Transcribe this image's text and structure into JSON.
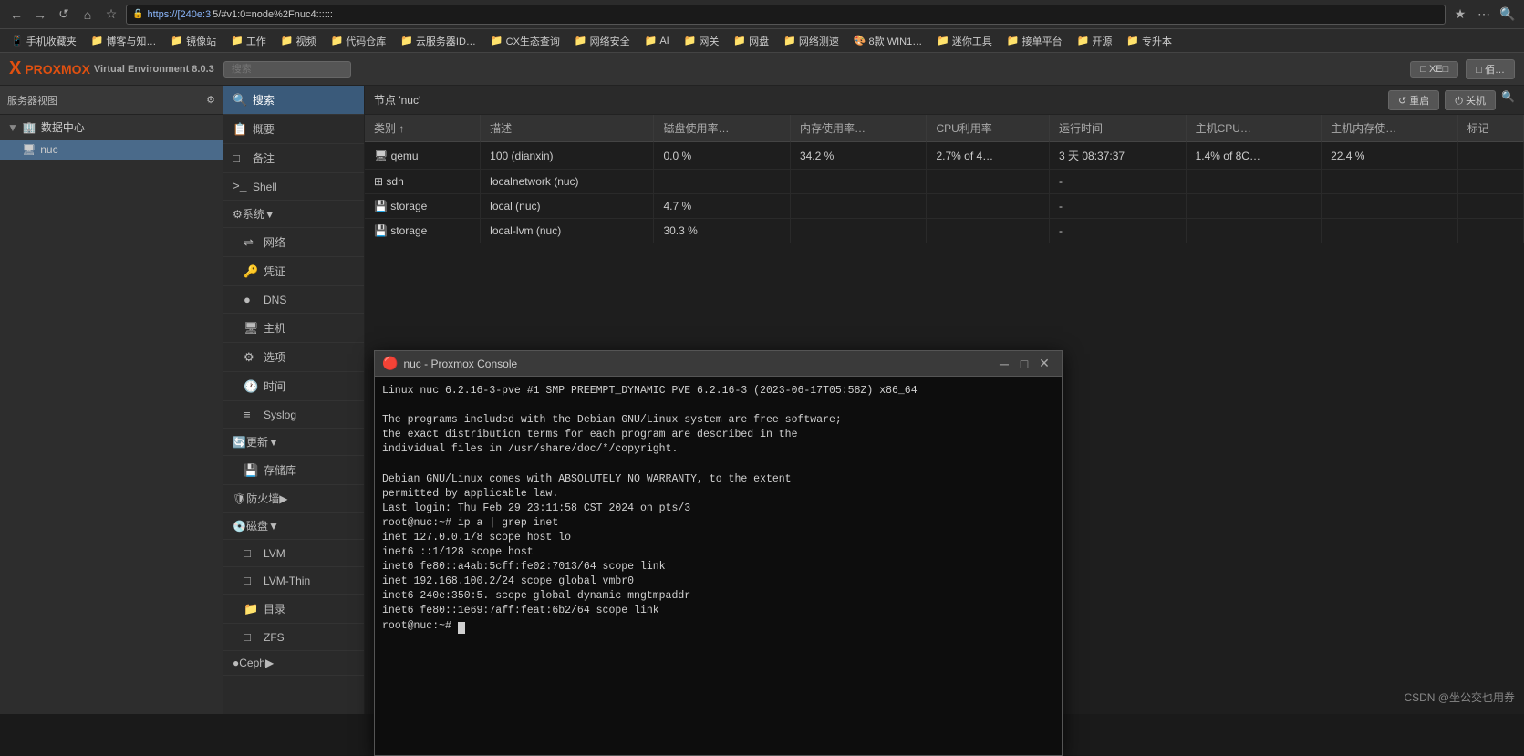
{
  "browser": {
    "url": "https://[240e:3",
    "url_full": "5/#v1:0=node%2Fnuc4::::::",
    "nav_back": "←",
    "nav_forward": "→",
    "nav_refresh": "↺",
    "nav_home": "⌂"
  },
  "bookmarks": [
    {
      "label": "手机收藏夹",
      "type": "folder"
    },
    {
      "label": "博客与知…",
      "type": "folder"
    },
    {
      "label": "镜像站",
      "type": "folder"
    },
    {
      "label": "工作",
      "type": "folder"
    },
    {
      "label": "视频",
      "type": "folder"
    },
    {
      "label": "代码仓库",
      "type": "folder"
    },
    {
      "label": "云服务器ID…",
      "type": "folder"
    },
    {
      "label": "CX生态查询",
      "type": "folder"
    },
    {
      "label": "网络安全",
      "type": "folder"
    },
    {
      "label": "AI",
      "type": "folder"
    },
    {
      "label": "网关",
      "type": "folder"
    },
    {
      "label": "网盘",
      "type": "folder"
    },
    {
      "label": "网络测速",
      "type": "folder"
    },
    {
      "label": "8款 WIN1…",
      "type": "folder"
    },
    {
      "label": "迷你工具",
      "type": "folder"
    },
    {
      "label": "接单平台",
      "type": "folder"
    },
    {
      "label": "开源",
      "type": "folder"
    },
    {
      "label": "专升本",
      "type": "folder"
    }
  ],
  "pve": {
    "logo_x": "X",
    "logo_name": "PROXMOX",
    "logo_ve": "Virtual Environment 8.0.3",
    "search_placeholder": "搜索",
    "header_buttons": [
      "□ XE□",
      "□ 佰…"
    ]
  },
  "sidebar": {
    "view_label": "服务器视图",
    "settings_icon": "⚙",
    "datacenter_label": "数据中心",
    "nodes": [
      {
        "label": "nuc",
        "icon": "🖥",
        "selected": true
      }
    ]
  },
  "nav": {
    "items": [
      {
        "icon": "🔍",
        "label": "搜索",
        "active": true
      },
      {
        "icon": "📋",
        "label": "概要"
      },
      {
        "icon": "□",
        "label": "备注"
      },
      {
        "icon": ">_",
        "label": "Shell"
      },
      {
        "icon": "⚙",
        "label": "系统",
        "has_arrow": true
      },
      {
        "icon": "🌐",
        "label": "网络",
        "indent": true
      },
      {
        "icon": "🔑",
        "label": "凭证",
        "indent": true
      },
      {
        "icon": "●",
        "label": "DNS",
        "indent": true
      },
      {
        "icon": "🖥",
        "label": "主机",
        "indent": true
      },
      {
        "icon": "⚙",
        "label": "选项",
        "indent": true
      },
      {
        "icon": "🕐",
        "label": "时间",
        "indent": true
      },
      {
        "icon": "≡",
        "label": "Syslog",
        "indent": true
      },
      {
        "icon": "🔄",
        "label": "更新",
        "has_arrow": true
      },
      {
        "icon": "💾",
        "label": "存储库",
        "indent": true
      },
      {
        "icon": "🛡",
        "label": "防火墙",
        "has_arrow": true
      },
      {
        "icon": "💿",
        "label": "磁盘",
        "has_arrow": true
      },
      {
        "icon": "□",
        "label": "LVM",
        "indent": true
      },
      {
        "icon": "□",
        "label": "LVM-Thin",
        "indent": true
      },
      {
        "icon": "📁",
        "label": "目录",
        "indent": true
      },
      {
        "icon": "□",
        "label": "ZFS",
        "indent": true
      },
      {
        "icon": "●",
        "label": "Ceph",
        "has_arrow": true
      }
    ]
  },
  "node_header": {
    "label": "节点 'nuc'",
    "btn_restart": "↺ 重启",
    "btn_shutdown": "⏻ 关机",
    "btn_search": "搜"
  },
  "table": {
    "columns": [
      "类别 ↑",
      "描述",
      "磁盘使用率…",
      "内存使用率…",
      "CPU利用率",
      "运行时间",
      "主机CPU…",
      "主机内存使…",
      "标记"
    ],
    "rows": [
      {
        "type": "vm",
        "type_icon": "🖥",
        "name": "qemu",
        "desc": "100 (dianxin)",
        "disk": "0.0 %",
        "mem": "34.2 %",
        "cpu": "2.7% of 4…",
        "uptime": "3 天 08:37:37",
        "hcpu": "1.4% of 8C…",
        "hmem": "22.4 %",
        "tag": ""
      },
      {
        "type": "net",
        "type_icon": "⊞",
        "name": "sdn",
        "desc": "localnetwork (nuc)",
        "disk": "",
        "mem": "",
        "cpu": "",
        "uptime": "-",
        "hcpu": "",
        "hmem": "",
        "tag": ""
      },
      {
        "type": "storage",
        "type_icon": "💾",
        "name": "storage",
        "desc": "local (nuc)",
        "disk": "4.7 %",
        "mem": "",
        "cpu": "",
        "uptime": "-",
        "hcpu": "",
        "hmem": "",
        "tag": ""
      },
      {
        "type": "storage",
        "type_icon": "💾",
        "name": "storage",
        "desc": "local-lvm (nuc)",
        "disk": "30.3 %",
        "mem": "",
        "cpu": "",
        "uptime": "-",
        "hcpu": "",
        "hmem": "",
        "tag": ""
      }
    ]
  },
  "console": {
    "title": "nuc - Proxmox Console",
    "favicon": "🔴",
    "terminal_lines": [
      "Linux nuc 6.2.16-3-pve #1 SMP PREEMPT_DYNAMIC PVE 6.2.16-3 (2023-06-17T05:58Z) x86_64",
      "",
      "The programs included with the Debian GNU/Linux system are free software;",
      "the exact distribution terms for each program are described in the",
      "individual files in /usr/share/doc/*/copyright.",
      "",
      "Debian GNU/Linux comes with ABSOLUTELY NO WARRANTY, to the extent",
      "permitted by applicable law.",
      "Last login: Thu Feb 29 23:11:58 CST 2024 on pts/3",
      "root@nuc:~# ip a | grep inet",
      "    inet 127.0.0.1/8 scope host lo",
      "    inet6 ::1/128 scope host",
      "    inet6 fe80::a4ab:5cff:fe02:7013/64 scope link",
      "    inet 192.168.100.2/24 scope global vmbr0",
      "    inet6 240e:350:5.              scope global dynamic mngtmpaddr",
      "    inet6 fe80::1e69:7aff:feat:6b2/64 scope link",
      "root@nuc:~# "
    ]
  },
  "watermark": "CSDN @坐公交也用券"
}
